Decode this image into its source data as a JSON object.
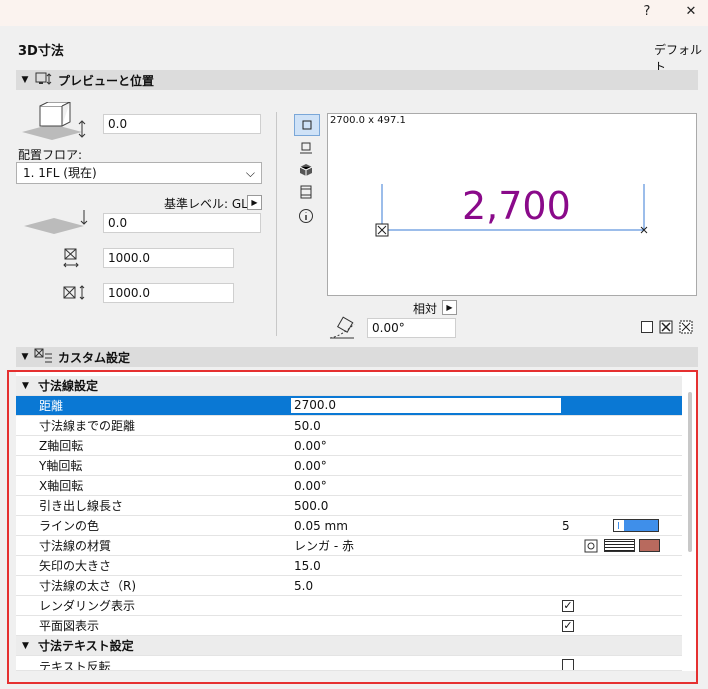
{
  "window": {
    "help": "?",
    "close": "✕"
  },
  "header": {
    "title": "3D寸法",
    "default_label": "デフォルト"
  },
  "preview_section": {
    "title": "プレビューと位置"
  },
  "left_panel": {
    "offset_value": "0.0",
    "floor_label": "配置フロア:",
    "floor_value": "1. 1FL (現在)",
    "ref_level_label": "基準レベル: GL",
    "elevation_value": "0.0",
    "width_value": "1000.0",
    "height_value": "1000.0"
  },
  "preview": {
    "size_label": "2700.0 x 497.1",
    "dimension_text": "2,700",
    "dimension_color": "#8a0a8a"
  },
  "rotation": {
    "relative_label": "相対",
    "angle_value": "0.00°"
  },
  "custom_section": {
    "title": "カスタム設定"
  },
  "grid": {
    "group1": "寸法線設定",
    "rows": [
      {
        "label": "距離",
        "value": "2700.0"
      },
      {
        "label": "寸法線までの距離",
        "value": "50.0"
      },
      {
        "label": "Z軸回転",
        "value": "0.00°"
      },
      {
        "label": "Y軸回転",
        "value": "0.00°"
      },
      {
        "label": "X軸回転",
        "value": "0.00°"
      },
      {
        "label": "引き出し線長さ",
        "value": "500.0"
      },
      {
        "label": "ラインの色",
        "value": "0.05 mm",
        "pen": "5"
      },
      {
        "label": "寸法線の材質",
        "value": "レンガ - 赤"
      },
      {
        "label": "矢印の大きさ",
        "value": "15.0"
      },
      {
        "label": "寸法線の太さ（R)",
        "value": "5.0"
      },
      {
        "label": "レンダリング表示",
        "checked": true
      },
      {
        "label": "平面図表示",
        "checked": true
      }
    ],
    "group2": "寸法テキスト設定",
    "row_after": {
      "label": "テキスト反転",
      "checked": false
    }
  },
  "colors": {
    "selection": "#0a78d4",
    "pen_color": "#3f8fea",
    "material_color": "#b86a5e",
    "frame": "#e53030"
  }
}
